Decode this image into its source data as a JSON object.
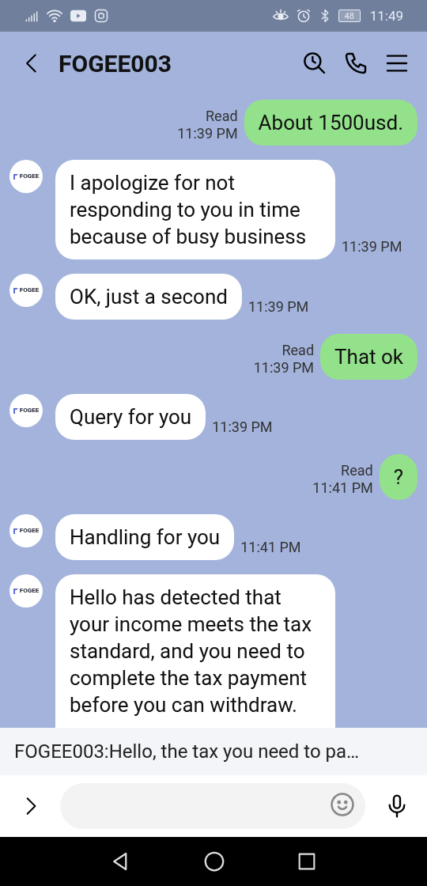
{
  "status_bar": {
    "battery": "48",
    "time": "11:49"
  },
  "header": {
    "title": "FOGEE003"
  },
  "messages": [
    {
      "kind": "sent",
      "text": "About 1500usd.",
      "read": "Read",
      "time": "11:39 PM"
    },
    {
      "kind": "received",
      "avatar": "FOGEE",
      "text": "I apologize for not responding to you in time because of busy business",
      "time": "11:39 PM"
    },
    {
      "kind": "received",
      "avatar": "FOGEE",
      "text": "OK, just a second",
      "time": "11:39 PM"
    },
    {
      "kind": "sent",
      "text": "That ok",
      "read": "Read",
      "time": "11:39 PM"
    },
    {
      "kind": "received",
      "avatar": "FOGEE",
      "text": "Query for you",
      "time": "11:39 PM"
    },
    {
      "kind": "sent",
      "text": "?",
      "read": "Read",
      "time": "11:41 PM"
    },
    {
      "kind": "received",
      "avatar": "FOGEE",
      "text": "Handling for you",
      "time": "11:41 PM"
    },
    {
      "kind": "received",
      "avatar": "FOGEE",
      "text": "Hello has detected that your income meets the tax standard, and you need to complete the tax payment before you can withdraw."
    }
  ],
  "notification": {
    "text": "FOGEE003:Hello, the tax you need to pa…"
  }
}
